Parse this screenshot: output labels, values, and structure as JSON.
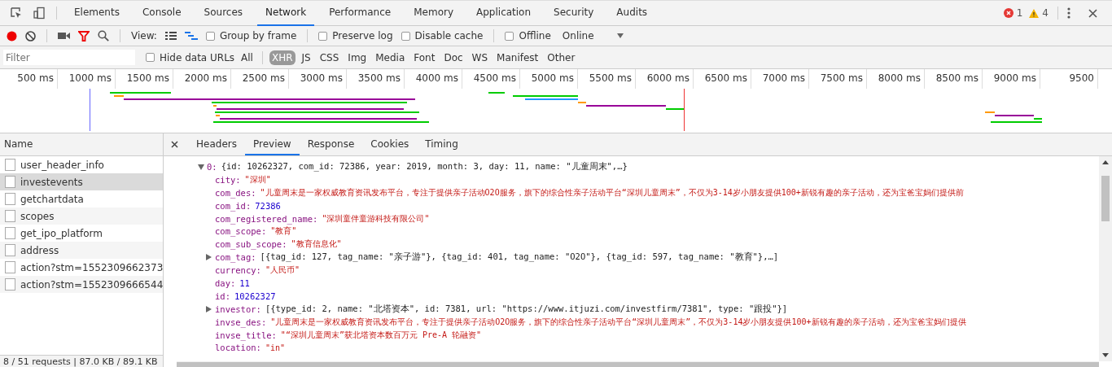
{
  "main_tabs": [
    {
      "label": "Elements",
      "selected": false
    },
    {
      "label": "Console",
      "selected": false
    },
    {
      "label": "Sources",
      "selected": false
    },
    {
      "label": "Network",
      "selected": true
    },
    {
      "label": "Performance",
      "selected": false
    },
    {
      "label": "Memory",
      "selected": false
    },
    {
      "label": "Application",
      "selected": false
    },
    {
      "label": "Security",
      "selected": false
    },
    {
      "label": "Audits",
      "selected": false
    }
  ],
  "status_counts": {
    "errors": "1",
    "warnings": "4"
  },
  "toolbar": {
    "recording": true,
    "view_label": "View:",
    "group_by_frame": {
      "label": "Group by frame",
      "checked": false
    },
    "preserve_log": {
      "label": "Preserve log",
      "checked": false
    },
    "disable_cache": {
      "label": "Disable cache",
      "checked": false
    },
    "offline": {
      "label": "Offline",
      "checked": false
    },
    "throttling": "Online"
  },
  "filter_bar": {
    "placeholder": "Filter",
    "hide_data_urls": {
      "label": "Hide data URLs",
      "checked": false
    },
    "types": [
      {
        "label": "All",
        "selected": false
      },
      {
        "label": "XHR",
        "selected": true
      },
      {
        "label": "JS",
        "selected": false
      },
      {
        "label": "CSS",
        "selected": false
      },
      {
        "label": "Img",
        "selected": false
      },
      {
        "label": "Media",
        "selected": false
      },
      {
        "label": "Font",
        "selected": false
      },
      {
        "label": "Doc",
        "selected": false
      },
      {
        "label": "WS",
        "selected": false
      },
      {
        "label": "Manifest",
        "selected": false
      },
      {
        "label": "Other",
        "selected": false
      }
    ]
  },
  "timeline": {
    "ticks": [
      "500 ms",
      "1000 ms",
      "1500 ms",
      "2000 ms",
      "2500 ms",
      "3000 ms",
      "3500 ms",
      "4000 ms",
      "4500 ms",
      "5000 ms",
      "5500 ms",
      "6000 ms",
      "6500 ms",
      "7000 ms",
      "7500 ms",
      "8000 ms",
      "8500 ms",
      "9000 ms",
      "9500"
    ]
  },
  "requests": {
    "column": "Name",
    "rows": [
      {
        "name": "user_header_info",
        "selected": false
      },
      {
        "name": "investevents",
        "selected": true
      },
      {
        "name": "getchartdata",
        "selected": false
      },
      {
        "name": "scopes",
        "selected": false
      },
      {
        "name": "get_ipo_platform",
        "selected": false
      },
      {
        "name": "address",
        "selected": false
      },
      {
        "name": "action?stm=1552309662373",
        "selected": false
      },
      {
        "name": "action?stm=1552309666544",
        "selected": false
      }
    ],
    "summary": "8 / 51 requests | 87.0 KB / 89.1 KB"
  },
  "detail_tabs": [
    {
      "label": "Headers",
      "selected": false
    },
    {
      "label": "Preview",
      "selected": true
    },
    {
      "label": "Response",
      "selected": false
    },
    {
      "label": "Cookies",
      "selected": false
    },
    {
      "label": "Timing",
      "selected": false
    }
  ],
  "preview": {
    "key": "0:",
    "value": "{id: 10262327, com_id: 72386, year: 2019, month: 3, day: 11, name: \"儿童周末\",…}",
    "kind": "object",
    "expanded": true,
    "children": [
      {
        "key": "city:",
        "value": "\"深圳\"",
        "kind": "string",
        "expandable": false
      },
      {
        "key": "com_des:",
        "value": "\"儿童周末是一家权威教育资讯发布平台，专注于提供亲子活动O2O服务，旗下的综合性亲子活动平台“深圳儿童周末”，不仅为3-14岁小朋友提供100+新锐有趣的亲子活动，还为宝爸宝妈们提供前",
        "kind": "string",
        "expandable": false
      },
      {
        "key": "com_id:",
        "value": "72386",
        "kind": "number",
        "expandable": false
      },
      {
        "key": "com_registered_name:",
        "value": "\"深圳童伴童游科技有限公司\"",
        "kind": "string",
        "expandable": false
      },
      {
        "key": "com_scope:",
        "value": "\"教育\"",
        "kind": "string",
        "expandable": false
      },
      {
        "key": "com_sub_scope:",
        "value": "\"教育信息化\"",
        "kind": "string",
        "expandable": false
      },
      {
        "key": "com_tag:",
        "value": "[{tag_id: 127, tag_name: \"亲子游\"}, {tag_id: 401, tag_name: \"O2O\"}, {tag_id: 597, tag_name: \"教育\"},…]",
        "kind": "object",
        "expandable": true
      },
      {
        "key": "currency:",
        "value": "\"人民币\"",
        "kind": "string",
        "expandable": false
      },
      {
        "key": "day:",
        "value": "11",
        "kind": "number",
        "expandable": false
      },
      {
        "key": "id:",
        "value": "10262327",
        "kind": "number",
        "expandable": false
      },
      {
        "key": "investor:",
        "value": "[{type_id: 2, name: \"北塔资本\", id: 7381, url: \"https://www.itjuzi.com/investfirm/7381\", type: \"跟投\"}]",
        "kind": "object",
        "expandable": true
      },
      {
        "key": "invse_des:",
        "value": "\"儿童周末是一家权威教育资讯发布平台，专注于提供亲子活动O2O服务，旗下的综合性亲子活动平台“深圳儿童周末”，不仅为3-14岁小朋友提供100+新锐有趣的亲子活动，还为宝爸宝妈们提供",
        "kind": "string",
        "expandable": false
      },
      {
        "key": "invse_title:",
        "value": "\"“深圳儿童周末”获北塔资本数百万元 Pre-A 轮融资\"",
        "kind": "string",
        "expandable": false
      },
      {
        "key": "location:",
        "value": "\"in\"",
        "kind": "string",
        "expandable": false
      }
    ]
  }
}
